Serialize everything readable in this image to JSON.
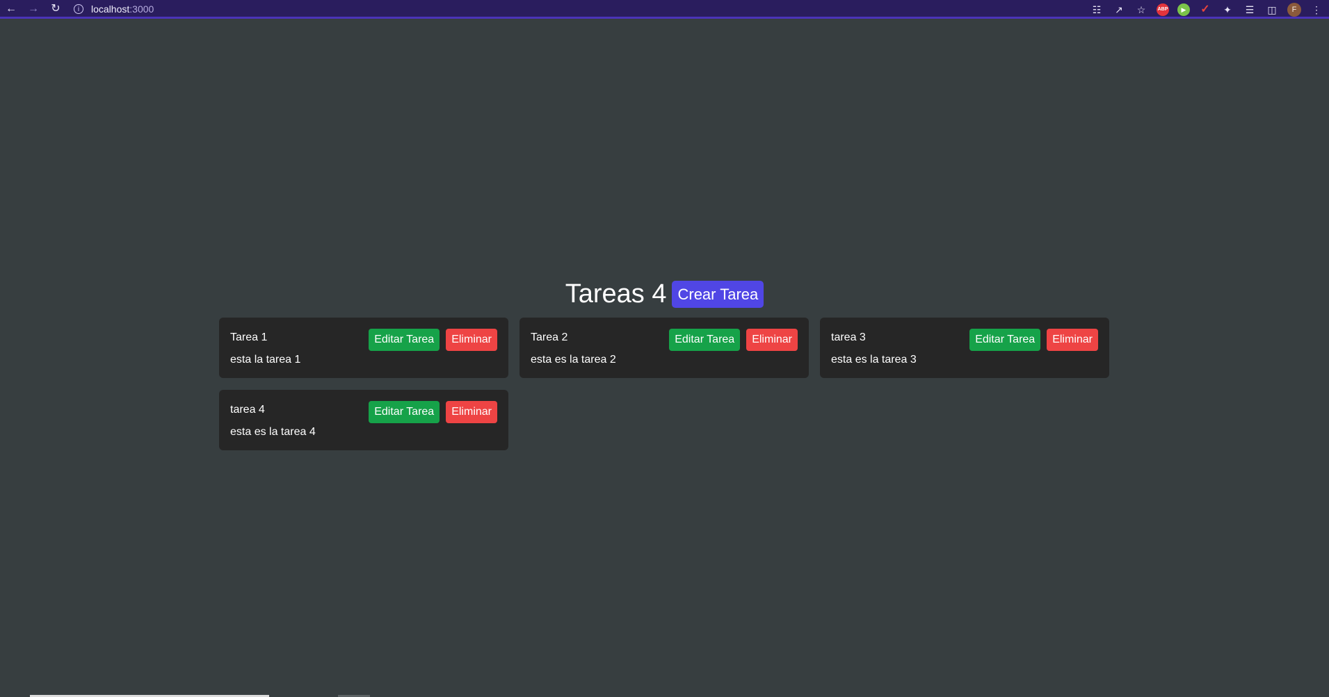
{
  "browser": {
    "url_host": "localhost",
    "url_port": ":3000",
    "nav": {
      "back_icon": "arrow-left-icon",
      "forward_icon": "arrow-right-icon",
      "reload_icon": "reload-icon"
    },
    "avatar_letter": "F",
    "extensions": {
      "abp_label": "ABP"
    }
  },
  "page": {
    "title": "Tareas 4",
    "create_button": "Crear Tarea"
  },
  "tasks": [
    {
      "title": "Tarea 1",
      "description": "esta la tarea 1",
      "edit_label": "Editar Tarea",
      "delete_label": "Eliminar"
    },
    {
      "title": "Tarea 2",
      "description": "esta es la tarea 2",
      "edit_label": "Editar Tarea",
      "delete_label": "Eliminar"
    },
    {
      "title": "tarea 3",
      "description": "esta es la tarea 3",
      "edit_label": "Editar Tarea",
      "delete_label": "Eliminar"
    },
    {
      "title": "tarea 4",
      "description": "esta es la tarea 4",
      "edit_label": "Editar Tarea",
      "delete_label": "Eliminar"
    }
  ],
  "colors": {
    "background": "#373e40",
    "card": "#262626",
    "create_button": "#5046e5",
    "edit_button": "#16a249",
    "delete_button": "#ee4444",
    "browser_bar": "#2a1d5e"
  }
}
